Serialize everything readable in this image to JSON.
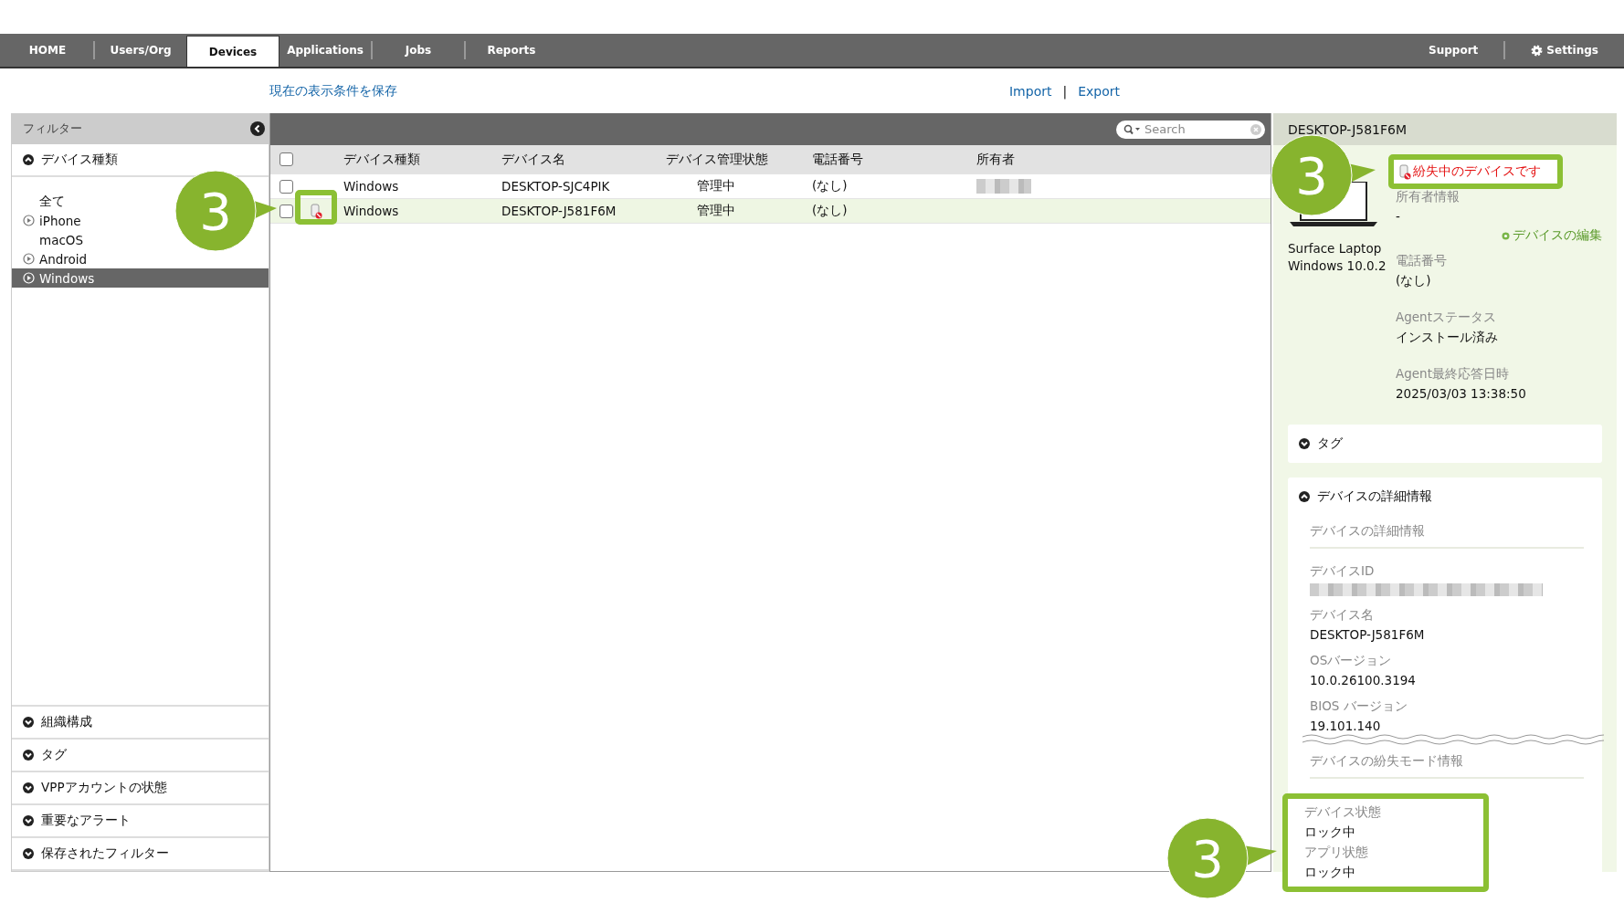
{
  "nav": {
    "tabs": [
      {
        "label": "HOME",
        "selected": false
      },
      {
        "label": "Users/Org",
        "selected": false
      },
      {
        "label": "Devices",
        "selected": true
      },
      {
        "label": "Applications",
        "selected": false
      },
      {
        "label": "Jobs",
        "selected": false
      },
      {
        "label": "Reports",
        "selected": false
      }
    ],
    "right": [
      {
        "label": "Support",
        "kind": "text"
      },
      {
        "label": "Settings",
        "kind": "gear"
      }
    ]
  },
  "links": {
    "save": "現在の表示条件を保存",
    "import": "Import",
    "separator": "|",
    "export": "Export"
  },
  "filter": {
    "title": "フィルター",
    "device_type": {
      "label": "デバイス種類",
      "expanded": true,
      "items": [
        {
          "label": "全て",
          "expandable": false,
          "selected": false
        },
        {
          "label": "iPhone",
          "expandable": true,
          "selected": false
        },
        {
          "label": "macOS",
          "expandable": false,
          "selected": false
        },
        {
          "label": "Android",
          "expandable": true,
          "selected": false
        },
        {
          "label": "Windows",
          "expandable": true,
          "selected": true
        }
      ]
    },
    "sections": [
      {
        "label": "組織構成",
        "expanded": false
      },
      {
        "label": "タグ",
        "expanded": false
      },
      {
        "label": "VPPアカウントの状態",
        "expanded": false
      },
      {
        "label": "重要なアラート",
        "expanded": false
      },
      {
        "label": "保存されたフィルター",
        "expanded": false
      }
    ]
  },
  "device_list": {
    "search": {
      "placeholder": "Search"
    },
    "select_all": {
      "checked": false
    },
    "columns": [
      "デバイス種類",
      "デバイス名",
      "デバイス管理状態",
      "電話番号",
      "所有者"
    ],
    "rows": [
      {
        "checked": false,
        "selected": false,
        "lost": false,
        "type": "Windows",
        "name": "DESKTOP-SJC4PIK",
        "status": "管理中",
        "phone": "(なし)",
        "owner_hidden": true
      },
      {
        "checked": false,
        "selected": true,
        "lost": true,
        "type": "Windows",
        "name": "DESKTOP-J581F6M",
        "status": "管理中",
        "phone": "(なし)",
        "owner_hidden": false
      }
    ]
  },
  "detail": {
    "title": "DESKTOP-J581F6M",
    "model": "Surface Laptop",
    "os": "Windows 10.0.2",
    "lost_badge": "紛失中のデバイスです",
    "owner": {
      "label": "所有者情報",
      "value": "-"
    },
    "edit_link": "デバイスの編集",
    "fields": [
      {
        "label": "電話番号",
        "value": "(なし)"
      },
      {
        "label": "Agentステータス",
        "value": "インストール済み"
      },
      {
        "label": "Agent最終応答日時",
        "value": "2025/03/03 13:38:50"
      }
    ],
    "tag_section": {
      "label": "タグ",
      "expanded": false
    },
    "details_section": {
      "label": "デバイスの詳細情報",
      "expanded": true,
      "groups": [
        {
          "heading": "デバイスの詳細情報",
          "highlighted": false,
          "fields": [
            {
              "label": "デバイスID",
              "hidden": true
            },
            {
              "label": "デバイス名",
              "value": "DESKTOP-J581F6M"
            },
            {
              "label": "OSバージョン",
              "value": "10.0.26100.3194"
            },
            {
              "label": "BIOS バージョン",
              "value": "19.101.140"
            }
          ]
        },
        {
          "heading": "デバイスの紛失モード情報",
          "highlighted": true,
          "fields": [
            {
              "label": "デバイス状態",
              "value": "ロック中"
            },
            {
              "label": "アプリ状態",
              "value": "ロック中"
            }
          ]
        }
      ]
    }
  },
  "callouts": [
    {
      "number": "3"
    },
    {
      "number": "3"
    },
    {
      "number": "3"
    }
  ]
}
